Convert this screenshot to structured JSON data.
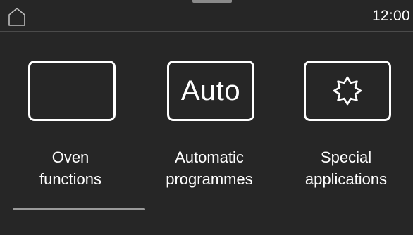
{
  "status_bar": {
    "time": "12:00",
    "home_icon": "home-icon"
  },
  "menu": {
    "items": [
      {
        "id": "oven-functions",
        "icon": "blank-box-icon",
        "line1": "Oven",
        "line2": "functions"
      },
      {
        "id": "automatic-programmes",
        "icon": "auto-icon",
        "icon_text": "Auto",
        "line1": "Automatic",
        "line2": "programmes"
      },
      {
        "id": "special-applications",
        "icon": "starburst-icon",
        "line1": "Special",
        "line2": "applications"
      }
    ]
  },
  "pager": {
    "active_page": 1,
    "page_count": 3
  },
  "colors": {
    "background": "#262626",
    "foreground": "#ffffff",
    "divider": "#4a4a4a",
    "indicator": "#9a9a9a"
  }
}
